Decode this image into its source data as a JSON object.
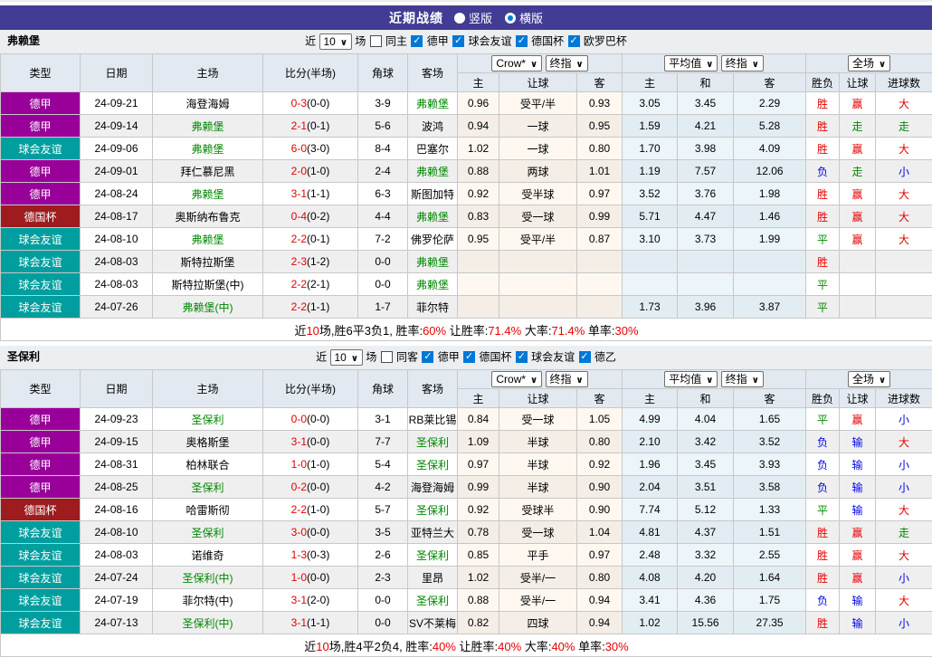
{
  "colors": {
    "accent_bar": "#423C94",
    "checkbox_blue": "#0078D7",
    "score_red": "#E60000",
    "focus_team_green": "#008800",
    "league": {
      "德甲": "#990099",
      "球会友谊": "#009E9E",
      "德国杯": "#9E1B1E"
    },
    "result": {
      "胜": "#E60000",
      "赢": "#E60000",
      "大": "#E60000",
      "负": "#0000E6",
      "输": "#0000E6",
      "小": "#0000E6",
      "平": "#008800",
      "走": "#008800"
    }
  },
  "title_bar": {
    "title": "近期战绩",
    "layout_options": [
      {
        "label": "竖版",
        "selected": false
      },
      {
        "label": "横版",
        "selected": true
      }
    ]
  },
  "columns": {
    "type": "类型",
    "date": "日期",
    "home": "主场",
    "score": "比分(半场)",
    "corner": "角球",
    "away": "客场",
    "g1_main": "主",
    "g1_handicap": "让球",
    "g1_away": "客",
    "g2_main": "主",
    "g2_draw": "和",
    "g2_away": "客",
    "g3_result": "胜负",
    "g3_handicap": "让球",
    "g3_goals": "进球数"
  },
  "header_selects": {
    "crow": "Crow*",
    "final1": "终指",
    "average": "平均值",
    "final2": "终指",
    "fullmatch": "全场"
  },
  "sections": [
    {
      "team": "弗赖堡",
      "filter": {
        "prefix": "近",
        "count": "10",
        "suffix": "场",
        "same_label": "同主",
        "same_checked": false,
        "leagues": [
          {
            "label": "德甲",
            "checked": true
          },
          {
            "label": "球会友谊",
            "checked": true
          },
          {
            "label": "德国杯",
            "checked": true
          },
          {
            "label": "欧罗巴杯",
            "checked": true
          }
        ]
      },
      "rows": [
        {
          "league": "德甲",
          "date": "24-09-21",
          "home": "海登海姆",
          "home_focus": false,
          "score": "0-3",
          "half": "(0-0)",
          "corner": "3-9",
          "away": "弗赖堡",
          "away_focus": true,
          "odds1": "0.96",
          "handicap": "受平/半",
          "odds2": "0.93",
          "avg_home": "3.05",
          "avg_draw": "3.45",
          "avg_away": "2.29",
          "res": "胜",
          "res_handicap": "赢",
          "res_goals": "大"
        },
        {
          "league": "德甲",
          "date": "24-09-14",
          "home": "弗赖堡",
          "home_focus": true,
          "score": "2-1",
          "half": "(0-1)",
          "corner": "5-6",
          "away": "波鸿",
          "away_focus": false,
          "odds1": "0.94",
          "handicap": "一球",
          "odds2": "0.95",
          "avg_home": "1.59",
          "avg_draw": "4.21",
          "avg_away": "5.28",
          "res": "胜",
          "res_handicap": "走",
          "res_goals": "走"
        },
        {
          "league": "球会友谊",
          "date": "24-09-06",
          "home": "弗赖堡",
          "home_focus": true,
          "score": "6-0",
          "half": "(3-0)",
          "corner": "8-4",
          "away": "巴塞尔",
          "away_focus": false,
          "odds1": "1.02",
          "handicap": "一球",
          "odds2": "0.80",
          "avg_home": "1.70",
          "avg_draw": "3.98",
          "avg_away": "4.09",
          "res": "胜",
          "res_handicap": "赢",
          "res_goals": "大"
        },
        {
          "league": "德甲",
          "date": "24-09-01",
          "home": "拜仁慕尼黑",
          "home_focus": false,
          "score": "2-0",
          "half": "(1-0)",
          "corner": "2-4",
          "away": "弗赖堡",
          "away_focus": true,
          "odds1": "0.88",
          "handicap": "两球",
          "odds2": "1.01",
          "avg_home": "1.19",
          "avg_draw": "7.57",
          "avg_away": "12.06",
          "res": "负",
          "res_handicap": "走",
          "res_goals": "小"
        },
        {
          "league": "德甲",
          "date": "24-08-24",
          "home": "弗赖堡",
          "home_focus": true,
          "score": "3-1",
          "half": "(1-1)",
          "corner": "6-3",
          "away": "斯图加特",
          "away_focus": false,
          "odds1": "0.92",
          "handicap": "受半球",
          "odds2": "0.97",
          "avg_home": "3.52",
          "avg_draw": "3.76",
          "avg_away": "1.98",
          "res": "胜",
          "res_handicap": "赢",
          "res_goals": "大"
        },
        {
          "league": "德国杯",
          "date": "24-08-17",
          "home": "奥斯纳布鲁克",
          "home_focus": false,
          "score": "0-4",
          "half": "(0-2)",
          "corner": "4-4",
          "away": "弗赖堡",
          "away_focus": true,
          "odds1": "0.83",
          "handicap": "受一球",
          "odds2": "0.99",
          "avg_home": "5.71",
          "avg_draw": "4.47",
          "avg_away": "1.46",
          "res": "胜",
          "res_handicap": "赢",
          "res_goals": "大"
        },
        {
          "league": "球会友谊",
          "date": "24-08-10",
          "home": "弗赖堡",
          "home_focus": true,
          "score": "2-2",
          "half": "(0-1)",
          "corner": "7-2",
          "away": "佛罗伦萨",
          "away_focus": false,
          "odds1": "0.95",
          "handicap": "受平/半",
          "odds2": "0.87",
          "avg_home": "3.10",
          "avg_draw": "3.73",
          "avg_away": "1.99",
          "res": "平",
          "res_handicap": "赢",
          "res_goals": "大"
        },
        {
          "league": "球会友谊",
          "date": "24-08-03",
          "home": "斯特拉斯堡",
          "home_focus": false,
          "score": "2-3",
          "half": "(1-2)",
          "corner": "0-0",
          "away": "弗赖堡",
          "away_focus": true,
          "odds1": "",
          "handicap": "",
          "odds2": "",
          "avg_home": "",
          "avg_draw": "",
          "avg_away": "",
          "res": "胜",
          "res_handicap": "",
          "res_goals": ""
        },
        {
          "league": "球会友谊",
          "date": "24-08-03",
          "home": "斯特拉斯堡(中)",
          "home_focus": false,
          "score": "2-2",
          "half": "(2-1)",
          "corner": "0-0",
          "away": "弗赖堡",
          "away_focus": true,
          "odds1": "",
          "handicap": "",
          "odds2": "",
          "avg_home": "",
          "avg_draw": "",
          "avg_away": "",
          "res": "平",
          "res_handicap": "",
          "res_goals": ""
        },
        {
          "league": "球会友谊",
          "date": "24-07-26",
          "home": "弗赖堡(中)",
          "home_focus": true,
          "score": "2-2",
          "half": "(1-1)",
          "corner": "1-7",
          "away": "菲尔特",
          "away_focus": false,
          "odds1": "",
          "handicap": "",
          "odds2": "",
          "avg_home": "1.73",
          "avg_draw": "3.96",
          "avg_away": "3.87",
          "res": "平",
          "res_handicap": "",
          "res_goals": ""
        }
      ],
      "summary": [
        [
          "近",
          "k"
        ],
        [
          "10",
          "r"
        ],
        [
          "场,胜6平3负1, 胜率:",
          "k"
        ],
        [
          "60%",
          "r"
        ],
        [
          " 让胜率:",
          "k"
        ],
        [
          "71.4%",
          "r"
        ],
        [
          " 大率:",
          "k"
        ],
        [
          "71.4%",
          "r"
        ],
        [
          " 单率:",
          "k"
        ],
        [
          "30%",
          "r"
        ]
      ]
    },
    {
      "team": "圣保利",
      "filter": {
        "prefix": "近",
        "count": "10",
        "suffix": "场",
        "same_label": "同客",
        "same_checked": false,
        "leagues": [
          {
            "label": "德甲",
            "checked": true
          },
          {
            "label": "德国杯",
            "checked": true
          },
          {
            "label": "球会友谊",
            "checked": true
          },
          {
            "label": "德乙",
            "checked": true
          }
        ]
      },
      "rows": [
        {
          "league": "德甲",
          "date": "24-09-23",
          "home": "圣保利",
          "home_focus": true,
          "score": "0-0",
          "half": "(0-0)",
          "corner": "3-1",
          "away": "RB莱比锡",
          "away_focus": false,
          "odds1": "0.84",
          "handicap": "受一球",
          "odds2": "1.05",
          "avg_home": "4.99",
          "avg_draw": "4.04",
          "avg_away": "1.65",
          "res": "平",
          "res_handicap": "赢",
          "res_goals": "小"
        },
        {
          "league": "德甲",
          "date": "24-09-15",
          "home": "奥格斯堡",
          "home_focus": false,
          "score": "3-1",
          "half": "(0-0)",
          "corner": "7-7",
          "away": "圣保利",
          "away_focus": true,
          "odds1": "1.09",
          "handicap": "半球",
          "odds2": "0.80",
          "avg_home": "2.10",
          "avg_draw": "3.42",
          "avg_away": "3.52",
          "res": "负",
          "res_handicap": "输",
          "res_goals": "大"
        },
        {
          "league": "德甲",
          "date": "24-08-31",
          "home": "柏林联合",
          "home_focus": false,
          "score": "1-0",
          "half": "(1-0)",
          "corner": "5-4",
          "away": "圣保利",
          "away_focus": true,
          "odds1": "0.97",
          "handicap": "半球",
          "odds2": "0.92",
          "avg_home": "1.96",
          "avg_draw": "3.45",
          "avg_away": "3.93",
          "res": "负",
          "res_handicap": "输",
          "res_goals": "小"
        },
        {
          "league": "德甲",
          "date": "24-08-25",
          "home": "圣保利",
          "home_focus": true,
          "score": "0-2",
          "half": "(0-0)",
          "corner": "4-2",
          "away": "海登海姆",
          "away_focus": false,
          "odds1": "0.99",
          "handicap": "半球",
          "odds2": "0.90",
          "avg_home": "2.04",
          "avg_draw": "3.51",
          "avg_away": "3.58",
          "res": "负",
          "res_handicap": "输",
          "res_goals": "小"
        },
        {
          "league": "德国杯",
          "date": "24-08-16",
          "home": "哈雷斯彻",
          "home_focus": false,
          "score": "2-2",
          "half": "(1-0)",
          "corner": "5-7",
          "away": "圣保利",
          "away_focus": true,
          "odds1": "0.92",
          "handicap": "受球半",
          "odds2": "0.90",
          "avg_home": "7.74",
          "avg_draw": "5.12",
          "avg_away": "1.33",
          "res": "平",
          "res_handicap": "输",
          "res_goals": "大"
        },
        {
          "league": "球会友谊",
          "date": "24-08-10",
          "home": "圣保利",
          "home_focus": true,
          "score": "3-0",
          "half": "(0-0)",
          "corner": "3-5",
          "away": "亚特兰大",
          "away_focus": false,
          "odds1": "0.78",
          "handicap": "受一球",
          "odds2": "1.04",
          "avg_home": "4.81",
          "avg_draw": "4.37",
          "avg_away": "1.51",
          "res": "胜",
          "res_handicap": "赢",
          "res_goals": "走"
        },
        {
          "league": "球会友谊",
          "date": "24-08-03",
          "home": "诺维奇",
          "home_focus": false,
          "score": "1-3",
          "half": "(0-3)",
          "corner": "2-6",
          "away": "圣保利",
          "away_focus": true,
          "odds1": "0.85",
          "handicap": "平手",
          "odds2": "0.97",
          "avg_home": "2.48",
          "avg_draw": "3.32",
          "avg_away": "2.55",
          "res": "胜",
          "res_handicap": "赢",
          "res_goals": "大"
        },
        {
          "league": "球会友谊",
          "date": "24-07-24",
          "home": "圣保利(中)",
          "home_focus": true,
          "score": "1-0",
          "half": "(0-0)",
          "corner": "2-3",
          "away": "里昂",
          "away_focus": false,
          "odds1": "1.02",
          "handicap": "受半/一",
          "odds2": "0.80",
          "avg_home": "4.08",
          "avg_draw": "4.20",
          "avg_away": "1.64",
          "res": "胜",
          "res_handicap": "赢",
          "res_goals": "小"
        },
        {
          "league": "球会友谊",
          "date": "24-07-19",
          "home": "菲尔特(中)",
          "home_focus": false,
          "score": "3-1",
          "half": "(2-0)",
          "corner": "0-0",
          "away": "圣保利",
          "away_focus": true,
          "odds1": "0.88",
          "handicap": "受半/一",
          "odds2": "0.94",
          "avg_home": "3.41",
          "avg_draw": "4.36",
          "avg_away": "1.75",
          "res": "负",
          "res_handicap": "输",
          "res_goals": "大"
        },
        {
          "league": "球会友谊",
          "date": "24-07-13",
          "home": "圣保利(中)",
          "home_focus": true,
          "score": "3-1",
          "half": "(1-1)",
          "corner": "0-0",
          "away": "SV不莱梅",
          "away_focus": false,
          "odds1": "0.82",
          "handicap": "四球",
          "odds2": "0.94",
          "avg_home": "1.02",
          "avg_draw": "15.56",
          "avg_away": "27.35",
          "res": "胜",
          "res_handicap": "输",
          "res_goals": "小"
        }
      ],
      "summary": [
        [
          "近",
          "k"
        ],
        [
          "10",
          "r"
        ],
        [
          "场,胜4平2负4, 胜率:",
          "k"
        ],
        [
          "40%",
          "r"
        ],
        [
          " 让胜率:",
          "k"
        ],
        [
          "40%",
          "r"
        ],
        [
          " 大率:",
          "k"
        ],
        [
          "40%",
          "r"
        ],
        [
          " 单率:",
          "k"
        ],
        [
          "30%",
          "r"
        ]
      ]
    }
  ]
}
